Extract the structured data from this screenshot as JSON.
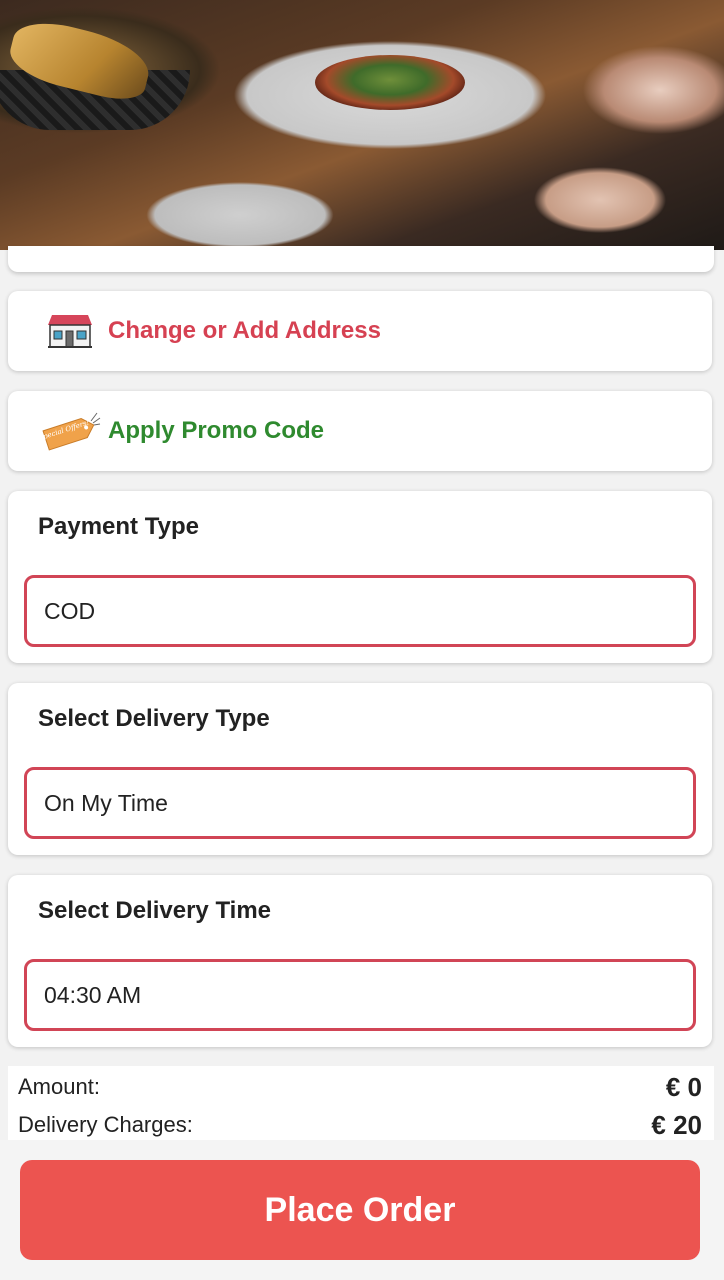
{
  "address_card": {
    "label": "Change or Add Address",
    "icon": "house-icon",
    "color": "#d64152"
  },
  "promo_card": {
    "label": "Apply Promo Code",
    "icon": "special-offer-tag-icon",
    "tag_text": "Special Offers!",
    "color": "#2f8a2f"
  },
  "payment": {
    "title": "Payment Type",
    "value": "COD"
  },
  "delivery_type": {
    "title": "Select Delivery Type",
    "value": "On My Time"
  },
  "delivery_time": {
    "title": "Select Delivery Time",
    "value": "04:30 AM"
  },
  "summary": {
    "amount_label": "Amount:",
    "amount_value": "€ 0",
    "delivery_label": "Delivery Charges:",
    "delivery_value": "€ 20"
  },
  "place_order": {
    "label": "Place Order",
    "color": "#ec5450"
  },
  "accent_border": "#d14556"
}
